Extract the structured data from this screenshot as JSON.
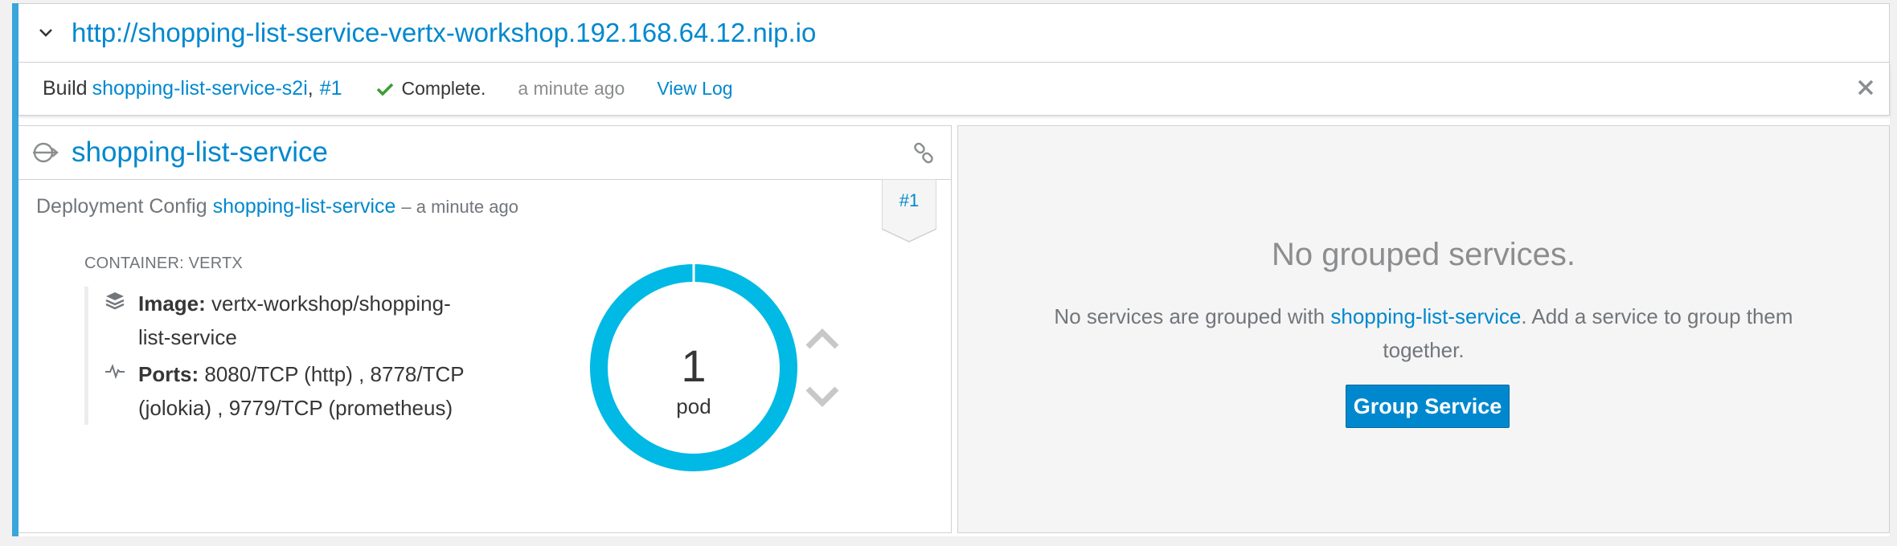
{
  "route": {
    "url": "http://shopping-list-service-vertx-workshop.192.168.64.12.nip.io"
  },
  "build": {
    "label": "Build",
    "name": "shopping-list-service-s2i",
    "separator": ",",
    "number": "#1",
    "status": "Complete.",
    "time": "a minute ago",
    "view_log": "View Log"
  },
  "deployment": {
    "service_name": "shopping-list-service",
    "config_label": "Deployment Config",
    "config_name": "shopping-list-service",
    "config_time": "– a minute ago",
    "badge": "#1",
    "container_label": "CONTAINER: VERTX",
    "image_key": "Image:",
    "image_value": "vertx-workshop/shopping-list-service",
    "ports_key": "Ports:",
    "ports_value": "8080/TCP (http) , 8778/TCP (jolokia) , 9779/TCP (prometheus)",
    "pod_count": "1",
    "pod_label": "pod"
  },
  "grouped": {
    "title": "No grouped services.",
    "text_before": "No services are grouped with",
    "link": "shopping-list-service",
    "text_after": ". Add a service to group them together.",
    "button": "Group Service"
  },
  "icons": {
    "chevron": "chevron-down-icon",
    "check": "check-icon",
    "close": "close-icon",
    "service": "service-icon",
    "link": "link-icon",
    "image": "layers-icon",
    "ports": "pulse-icon",
    "scale_up": "chevron-up-icon",
    "scale_down": "chevron-down-icon"
  },
  "colors": {
    "accent": "#39a5dc",
    "link": "#0088ce",
    "success": "#3f9c35",
    "donut": "#00b9e4"
  }
}
